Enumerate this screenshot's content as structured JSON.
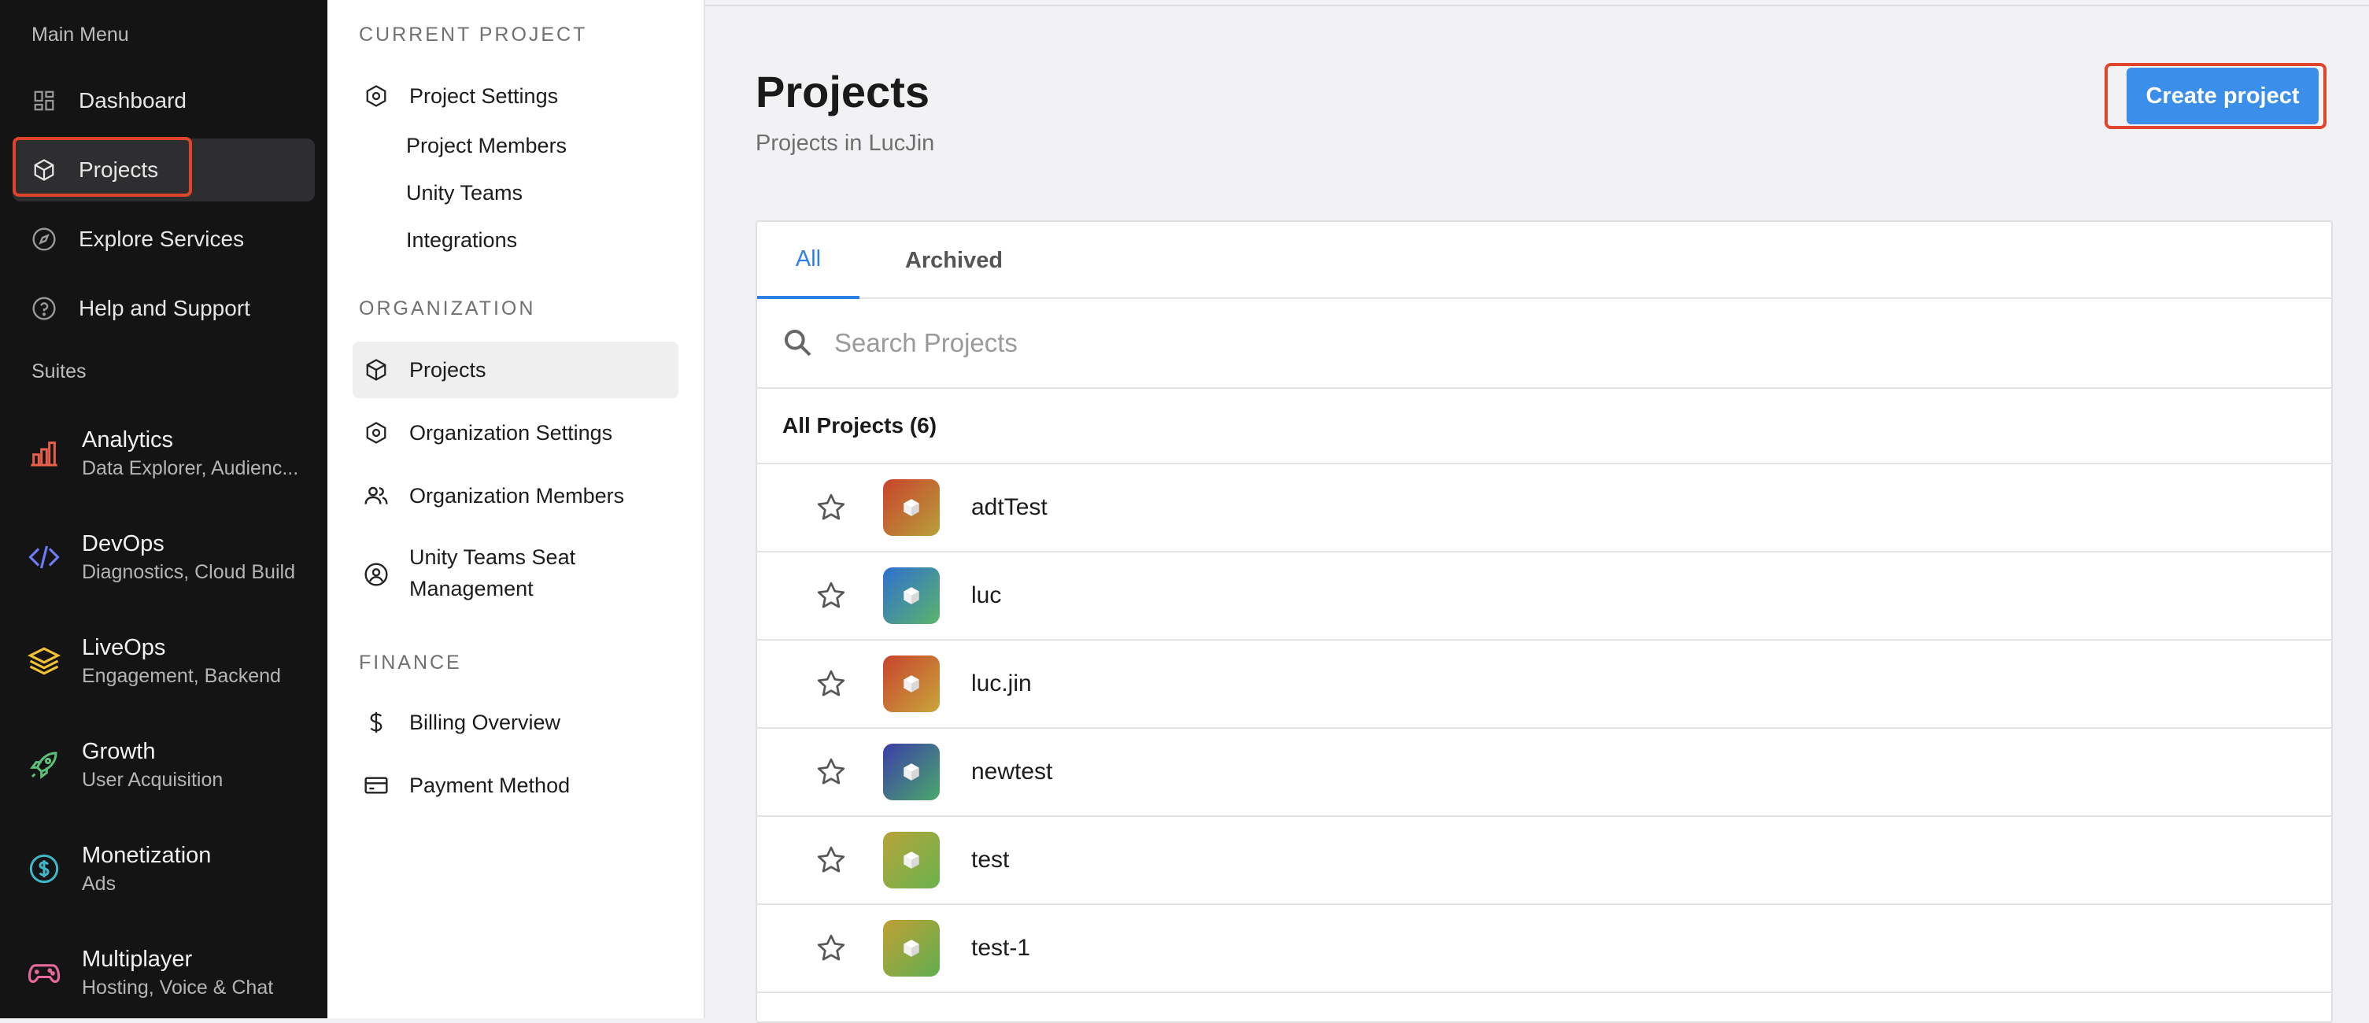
{
  "main_menu": {
    "title": "Main Menu",
    "items": [
      {
        "label": "Dashboard",
        "icon": "dashboard-icon"
      },
      {
        "label": "Projects",
        "icon": "cube-icon"
      },
      {
        "label": "Explore Services",
        "icon": "compass-icon"
      },
      {
        "label": "Help and Support",
        "icon": "help-icon"
      }
    ],
    "active": "Projects"
  },
  "suites": {
    "title": "Suites",
    "items": [
      {
        "label": "Analytics",
        "sub": "Data Explorer, Audienc...",
        "icon": "bar-chart-icon",
        "color": "#e8604c"
      },
      {
        "label": "DevOps",
        "sub": "Diagnostics, Cloud Build",
        "icon": "code-icon",
        "color": "#6b7cf6"
      },
      {
        "label": "LiveOps",
        "sub": "Engagement, Backend",
        "icon": "layers-icon",
        "color": "#f2c230"
      },
      {
        "label": "Growth",
        "sub": "User Acquisition",
        "icon": "rocket-icon",
        "color": "#5bbf7a"
      },
      {
        "label": "Monetization",
        "sub": "Ads",
        "icon": "dollar-circle-icon",
        "color": "#3fb7c9"
      },
      {
        "label": "Multiplayer",
        "sub": "Hosting, Voice & Chat",
        "icon": "gamepad-icon",
        "color": "#e86a9a"
      }
    ]
  },
  "sub_nav": {
    "current_project": {
      "heading": "CURRENT PROJECT",
      "settings": "Project Settings",
      "children": [
        "Project Members",
        "Unity Teams",
        "Integrations"
      ]
    },
    "organization": {
      "heading": "ORGANIZATION",
      "items": [
        "Projects",
        "Organization Settings",
        "Organization Members"
      ],
      "seat_line1": "Unity Teams Seat",
      "seat_line2": "Management"
    },
    "finance": {
      "heading": "FINANCE",
      "items": [
        "Billing Overview",
        "Payment Method"
      ]
    }
  },
  "main": {
    "title": "Projects",
    "subtitle": "Projects in LucJin",
    "create_label": "Create project",
    "tabs": [
      "All",
      "Archived"
    ],
    "active_tab": "All",
    "search_placeholder": "Search Projects",
    "list_heading": "All Projects (6)",
    "projects": [
      {
        "name": "adtTest",
        "gradient": [
          "#c8432d",
          "#b8a03a"
        ]
      },
      {
        "name": "luc",
        "gradient": [
          "#2f6fd0",
          "#5bb56a"
        ]
      },
      {
        "name": "luc.jin",
        "gradient": [
          "#c8432d",
          "#c8a63a"
        ]
      },
      {
        "name": "newtest",
        "gradient": [
          "#3c3ea8",
          "#4aa86b"
        ]
      },
      {
        "name": "test",
        "gradient": [
          "#b6a43a",
          "#6ab24d"
        ]
      },
      {
        "name": "test-1",
        "gradient": [
          "#c0a035",
          "#5fae4f"
        ]
      }
    ]
  },
  "colors": {
    "accent": "#3b8eea",
    "highlight": "#e0452c"
  }
}
